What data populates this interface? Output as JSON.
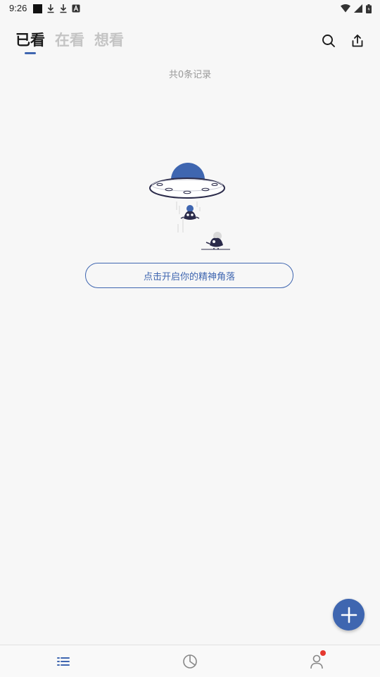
{
  "status_bar": {
    "time": "9:26"
  },
  "header": {
    "tabs": [
      {
        "label": "已看",
        "active": true
      },
      {
        "label": "在看",
        "active": false
      },
      {
        "label": "想看",
        "active": false
      }
    ],
    "search_icon": "search-icon",
    "share_icon": "share-icon"
  },
  "main": {
    "record_count": "共0条记录",
    "illustration": "ufo-empty-state",
    "start_button_label": "点击开启你的精神角落"
  },
  "fab_icon": "plus-icon",
  "bottom_nav": {
    "items": [
      {
        "icon": "list-icon",
        "active": true
      },
      {
        "icon": "pie-chart-icon",
        "active": false
      },
      {
        "icon": "profile-icon",
        "active": false,
        "badge": true
      }
    ]
  },
  "colors": {
    "accent": "#3f66b0",
    "background": "#f7f7f7",
    "tab_inactive": "#c4c4c4",
    "badge": "#e5392f"
  }
}
